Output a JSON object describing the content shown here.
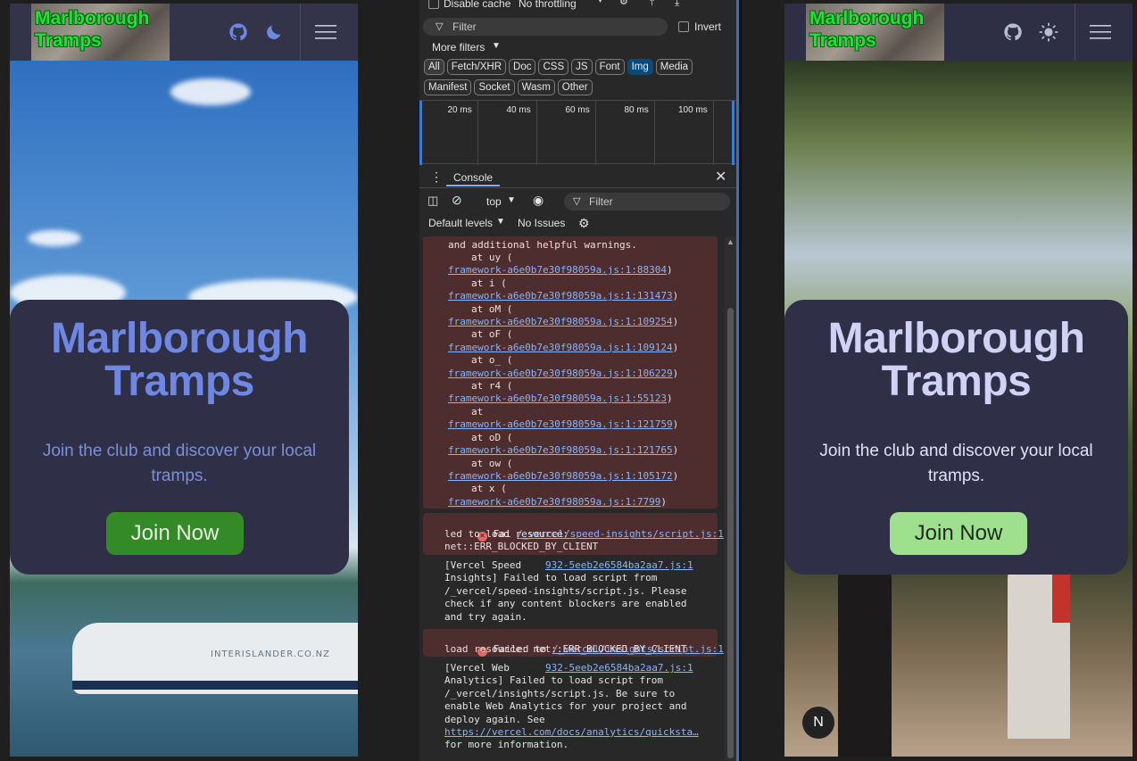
{
  "site": {
    "logo_text_1": "Marlborough",
    "logo_text_2": "Tramps",
    "hero_title_1": "Marlborough",
    "hero_title_2": "Tramps",
    "hero_subtitle": "Join the club and discover your local tramps.",
    "join_label": "Join Now",
    "ferry_text": "INTERISLANDER.CO.NZ",
    "next_badge": "N"
  },
  "devtools": {
    "disable_cache_label": "Disable cache",
    "throttling_label": "No throttling",
    "filter_placeholder": "Filter",
    "invert_label": "Invert",
    "more_filters_label": "More filters",
    "type_chips": [
      "All",
      "Fetch/XHR",
      "Doc",
      "CSS",
      "JS",
      "Font",
      "Img",
      "Media"
    ],
    "type_chips_row2": [
      "Manifest",
      "Socket",
      "Wasm",
      "Other"
    ],
    "active_chip": "Img",
    "timeline_labels": [
      "20 ms",
      "40 ms",
      "60 ms",
      "80 ms",
      "100 ms"
    ],
    "console_tab_label": "Console",
    "context_label": "top",
    "console_filter_placeholder": "Filter",
    "levels_label": "Default levels",
    "issues_label": "No Issues"
  },
  "console_log": {
    "trace_header": "and additional helpful warnings.",
    "trace_lines": [
      {
        "fn": "at uy (",
        "loc": "framework-a6e0b7e30f98059a.js:1:88304"
      },
      {
        "fn": "at i (",
        "loc": "framework-a6e0b7e30f98059a.js:1:131473"
      },
      {
        "fn": "at oM (",
        "loc": "framework-a6e0b7e30f98059a.js:1:109254"
      },
      {
        "fn": "at oF (",
        "loc": "framework-a6e0b7e30f98059a.js:1:109124"
      },
      {
        "fn": "at o_ (",
        "loc": "framework-a6e0b7e30f98059a.js:1:106229"
      },
      {
        "fn": "at r4 (",
        "loc": "framework-a6e0b7e30f98059a.js:1:55123"
      },
      {
        "fn": "at",
        "loc": "framework-a6e0b7e30f98059a.js:1:121759"
      },
      {
        "fn": "at oD (",
        "loc": "framework-a6e0b7e30f98059a.js:1:121765"
      },
      {
        "fn": "at ow (",
        "loc": "framework-a6e0b7e30f98059a.js:1:105172"
      },
      {
        "fn": "at x (",
        "loc": "framework-a6e0b7e30f98059a.js:1:7799"
      }
    ],
    "err1_prefix": "Fai",
    "err1_link": "/_vercel/speed-insights/script.js:1",
    "err1_line2": "led to load resource:",
    "err1_line3": "net::ERR_BLOCKED_BY_CLIENT",
    "msg1_src": "932-5eeb2e6584ba2aa7.js:1",
    "msg1_lines": [
      "[Vercel Speed",
      "Insights] Failed to load script from",
      "/_vercel/speed-insights/script.js. Please",
      "check if any content blockers are enabled",
      "and try again."
    ],
    "err2_prefix": "Failed to",
    "err2_link": "/_vercel/insights/script.js:1",
    "err2_line2": "load resource: net::ERR_BLOCKED_BY_CLIENT",
    "msg2_src": "932-5eeb2e6584ba2aa7.js:1",
    "msg2_lines": [
      "[Vercel Web",
      "Analytics] Failed to load script from",
      "/_vercel/insights/script.js. Be sure to",
      "enable Web Analytics for your project and",
      "deploy again. See"
    ],
    "msg2_link": "https://vercel.com/docs/analytics/quicksta…",
    "msg2_tail": "for more information."
  }
}
